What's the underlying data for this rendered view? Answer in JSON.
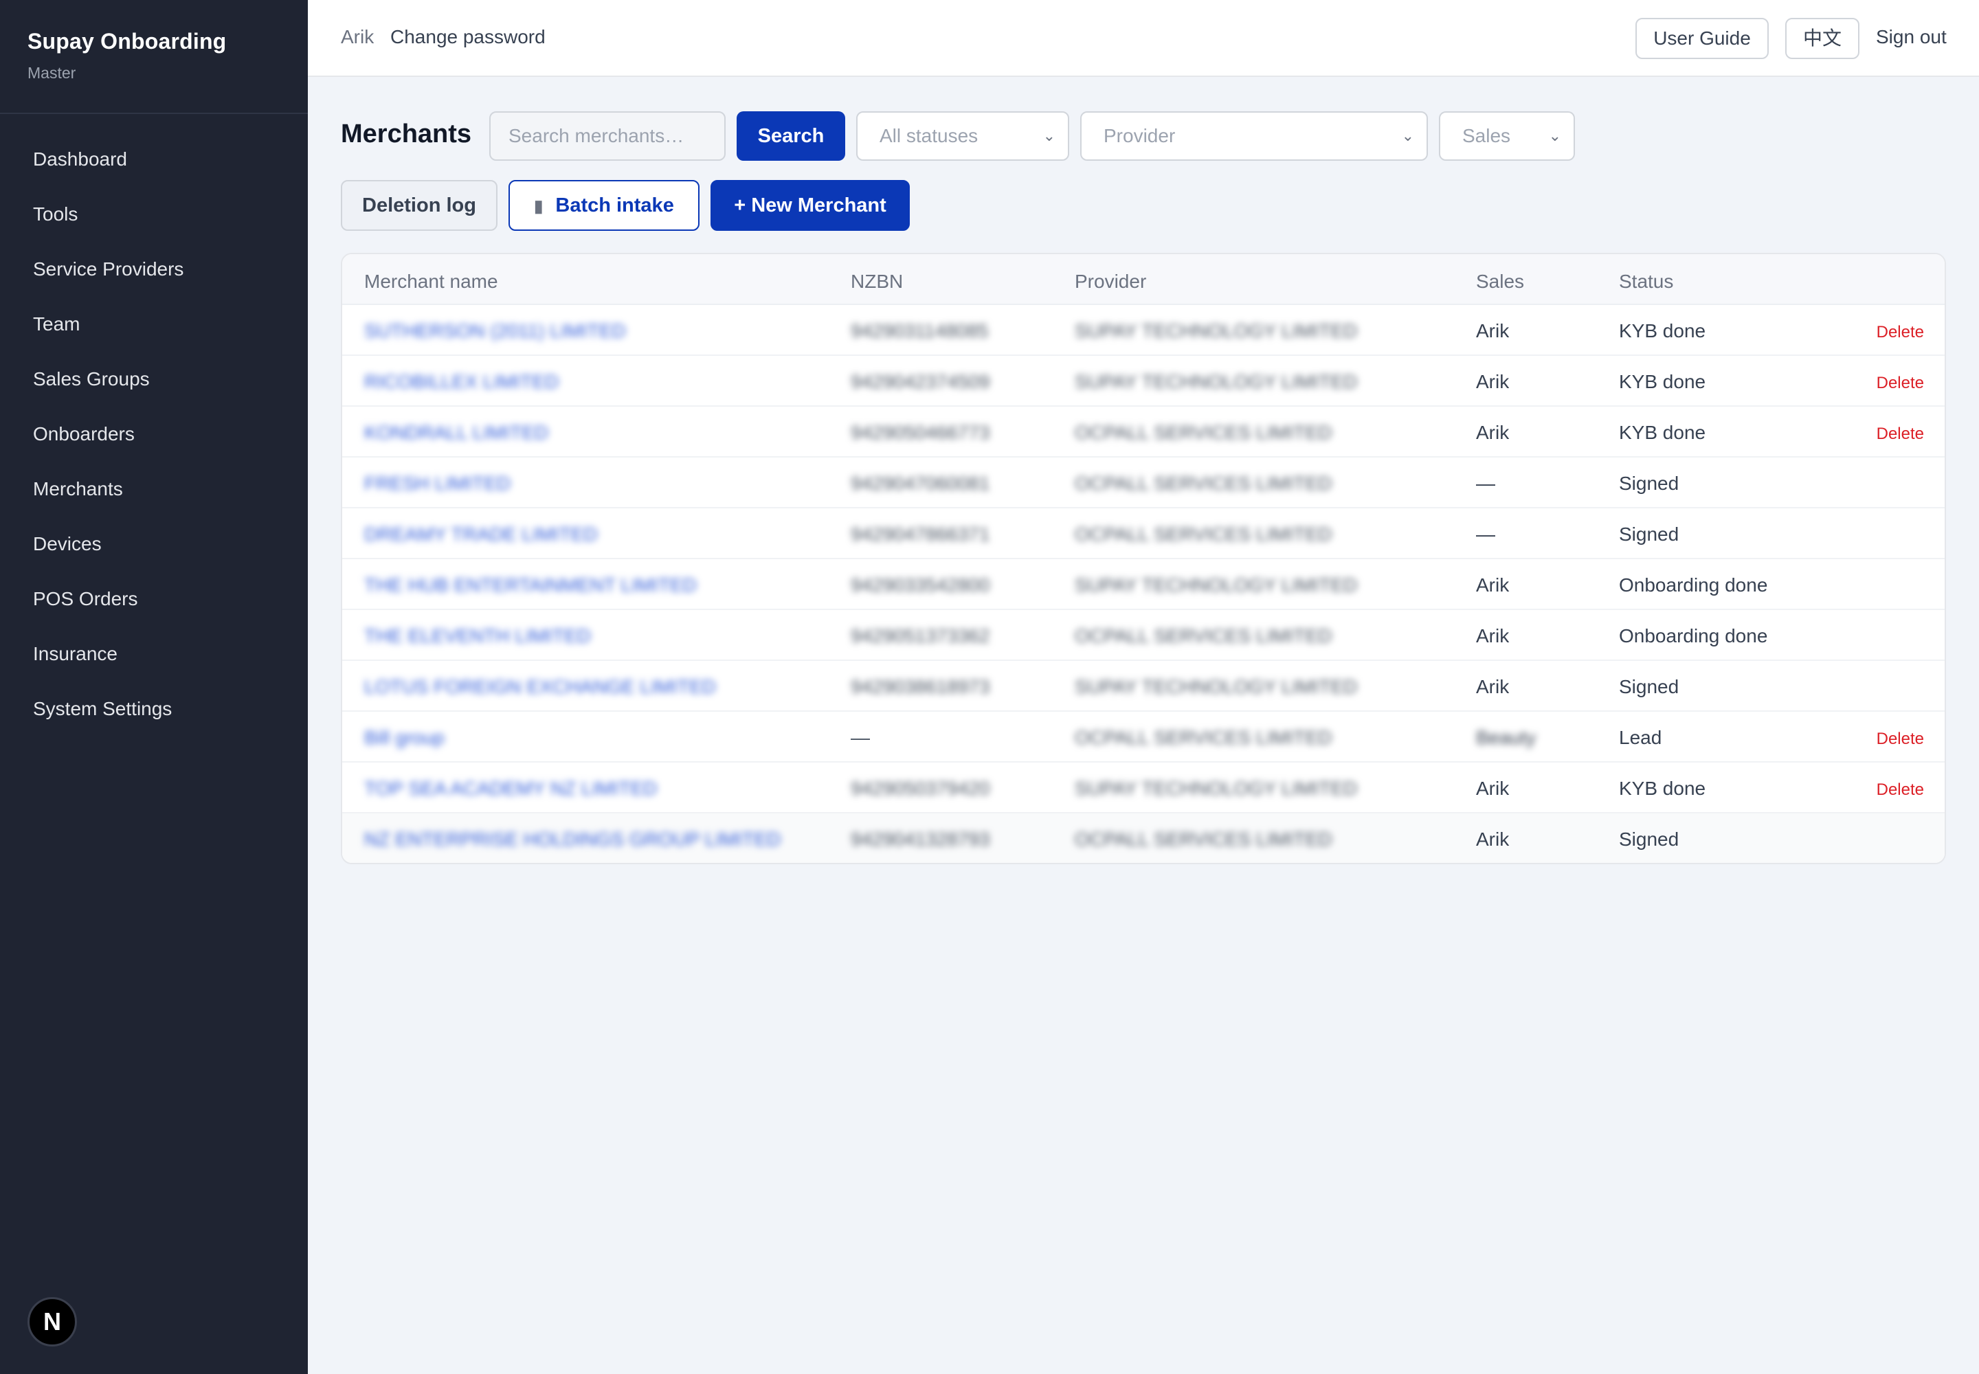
{
  "app": {
    "title": "Supay Onboarding",
    "subtitle": "Master"
  },
  "sidebar": {
    "items": [
      {
        "label": "Dashboard"
      },
      {
        "label": "Tools"
      },
      {
        "label": "Service Providers"
      },
      {
        "label": "Team"
      },
      {
        "label": "Sales Groups"
      },
      {
        "label": "Onboarders"
      },
      {
        "label": "Merchants"
      },
      {
        "label": "Devices"
      },
      {
        "label": "POS Orders"
      },
      {
        "label": "Insurance"
      },
      {
        "label": "System Settings"
      }
    ],
    "badge": "N"
  },
  "topbar": {
    "user": "Arik",
    "change_password": "Change password",
    "user_guide": "User Guide",
    "language": "中文",
    "sign_out": "Sign out"
  },
  "toolbar": {
    "title": "Merchants",
    "search_placeholder": "Search merchants…",
    "search_label": "Search",
    "status_filter": "All statuses",
    "provider_filter": "Provider",
    "sales_filter": "Sales",
    "deletion_log": "Deletion log",
    "batch_intake": "Batch intake",
    "new_merchant": "+ New Merchant"
  },
  "table": {
    "columns": [
      "Merchant name",
      "NZBN",
      "Provider",
      "Sales",
      "Status"
    ],
    "delete_label": "Delete",
    "rows": [
      {
        "name": "SUTHERSON (2011) LIMITED",
        "nzbn": "9429031148085",
        "provider": "SUPAY TECHNOLOGY LIMITED",
        "sales": "Arik",
        "status": "KYB done",
        "deletable": true
      },
      {
        "name": "RICOBILLEX LIMITED",
        "nzbn": "9429042374509",
        "provider": "SUPAY TECHNOLOGY LIMITED",
        "sales": "Arik",
        "status": "KYB done",
        "deletable": true
      },
      {
        "name": "KONDRALL LIMITED",
        "nzbn": "9429050466773",
        "provider": "OCPALL SERVICES LIMITED",
        "sales": "Arik",
        "status": "KYB done",
        "deletable": true
      },
      {
        "name": "FRESH LIMITED",
        "nzbn": "9429047060081",
        "provider": "OCPALL SERVICES LIMITED",
        "sales": "—",
        "status": "Signed",
        "deletable": false
      },
      {
        "name": "DREAMY TRADE LIMITED",
        "nzbn": "9429047866371",
        "provider": "OCPALL SERVICES LIMITED",
        "sales": "—",
        "status": "Signed",
        "deletable": false
      },
      {
        "name": "THE HUB ENTERTAINMENT LIMITED",
        "nzbn": "9429033542800",
        "provider": "SUPAY TECHNOLOGY LIMITED",
        "sales": "Arik",
        "status": "Onboarding done",
        "deletable": false
      },
      {
        "name": "THE ELEVENTH LIMITED",
        "nzbn": "9429051373362",
        "provider": "OCPALL SERVICES LIMITED",
        "sales": "Arik",
        "status": "Onboarding done",
        "deletable": false
      },
      {
        "name": "LOTUS FOREIGN EXCHANGE LIMITED",
        "nzbn": "9429038618973",
        "provider": "SUPAY TECHNOLOGY LIMITED",
        "sales": "Arik",
        "status": "Signed",
        "deletable": false
      },
      {
        "name": "Bill group",
        "nzbn": "—",
        "provider": "OCPALL SERVICES LIMITED",
        "sales": "Beauty",
        "status": "Lead",
        "deletable": true
      },
      {
        "name": "TOP SEA ACADEMY NZ LIMITED",
        "nzbn": "9429050379420",
        "provider": "SUPAY TECHNOLOGY LIMITED",
        "sales": "Arik",
        "status": "KYB done",
        "deletable": true
      },
      {
        "name": "NZ ENTERPRISE HOLDINGS GROUP LIMITED",
        "nzbn": "9429041328793",
        "provider": "OCPALL SERVICES LIMITED",
        "sales": "Arik",
        "status": "Signed",
        "deletable": false
      }
    ]
  }
}
